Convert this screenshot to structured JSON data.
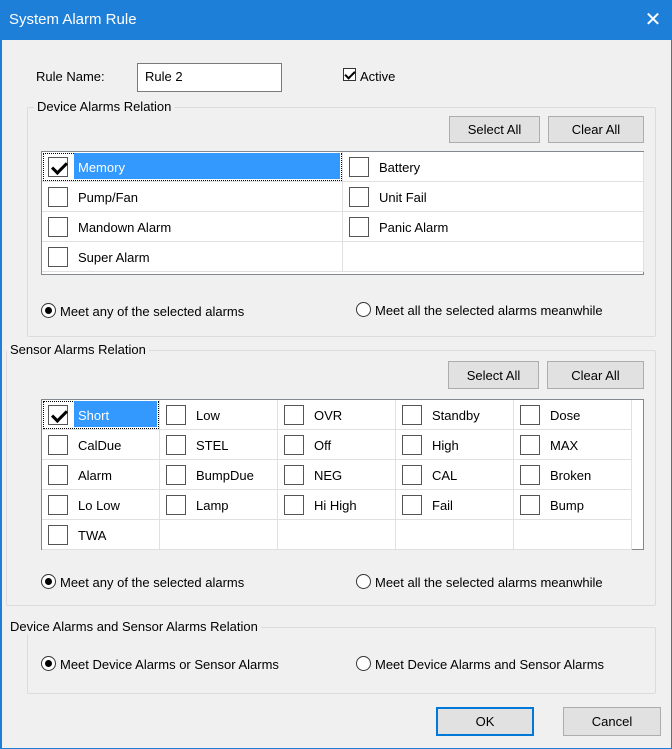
{
  "window": {
    "title": "System Alarm Rule",
    "close_glyph": "✕"
  },
  "rule": {
    "name_label": "Rule Name:",
    "name_value": "Rule 2",
    "active_label": "Active",
    "active_checked": true
  },
  "device": {
    "group_title": "Device Alarms Relation",
    "select_all": "Select All",
    "clear_all": "Clear All",
    "items": [
      {
        "label": "Memory",
        "checked": true,
        "selected": true
      },
      {
        "label": "Battery",
        "checked": false
      },
      {
        "label": "Pump/Fan",
        "checked": false
      },
      {
        "label": "Unit Fail",
        "checked": false
      },
      {
        "label": "Mandown Alarm",
        "checked": false
      },
      {
        "label": "Panic Alarm",
        "checked": false
      },
      {
        "label": "Super Alarm",
        "checked": false
      }
    ],
    "option_any": "Meet any of the selected alarms",
    "option_all": "Meet all the selected alarms meanwhile",
    "selected_option": "any"
  },
  "sensor": {
    "group_title": "Sensor Alarms Relation",
    "select_all": "Select All",
    "clear_all": "Clear All",
    "items": [
      {
        "label": "Short",
        "checked": true,
        "selected": true
      },
      {
        "label": "Low",
        "checked": false
      },
      {
        "label": "OVR",
        "checked": false
      },
      {
        "label": "Standby",
        "checked": false
      },
      {
        "label": "Dose",
        "checked": false
      },
      {
        "label": "CalDue",
        "checked": false
      },
      {
        "label": "STEL",
        "checked": false
      },
      {
        "label": "Off",
        "checked": false
      },
      {
        "label": "High",
        "checked": false
      },
      {
        "label": "MAX",
        "checked": false
      },
      {
        "label": "Alarm",
        "checked": false
      },
      {
        "label": "BumpDue",
        "checked": false
      },
      {
        "label": "NEG",
        "checked": false
      },
      {
        "label": "CAL",
        "checked": false
      },
      {
        "label": "Broken",
        "checked": false
      },
      {
        "label": "Lo Low",
        "checked": false
      },
      {
        "label": "Lamp",
        "checked": false
      },
      {
        "label": "Hi High",
        "checked": false
      },
      {
        "label": "Fail",
        "checked": false
      },
      {
        "label": "Bump",
        "checked": false
      },
      {
        "label": "TWA",
        "checked": false
      }
    ],
    "option_any": "Meet any of the selected alarms",
    "option_all": "Meet all the selected alarms meanwhile",
    "selected_option": "any"
  },
  "relation": {
    "group_title": "Device Alarms and Sensor Alarms Relation",
    "option_or": "Meet Device Alarms or Sensor Alarms",
    "option_and": "Meet Device Alarms and Sensor Alarms",
    "selected_option": "or"
  },
  "footer": {
    "ok": "OK",
    "cancel": "Cancel"
  }
}
